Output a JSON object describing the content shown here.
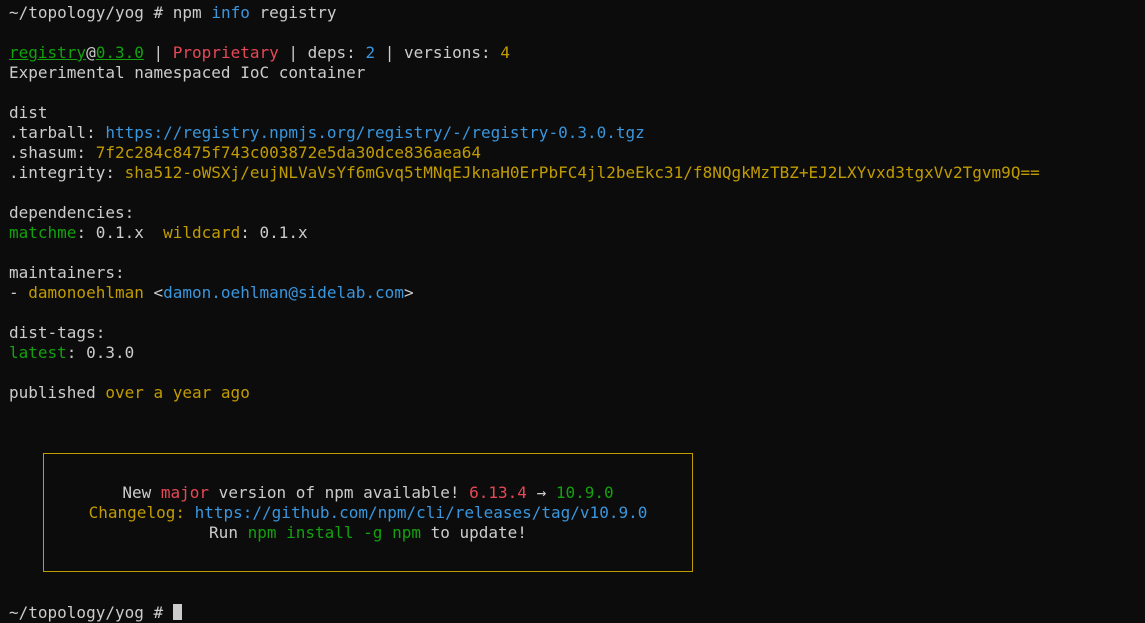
{
  "terminal": {
    "command_line": {
      "prompt": "~/topology/yog # ",
      "cmd": "npm",
      "arg1": "info",
      "arg2": "registry"
    },
    "header": {
      "name": "registry",
      "at": "@",
      "version": "0.3.0",
      "sep1": " | ",
      "license": "Proprietary",
      "sep2": " | deps: ",
      "deps": "2",
      "sep3": " | versions: ",
      "versions": "4"
    },
    "description": "Experimental namespaced IoC container",
    "dist": {
      "heading": "dist",
      "tarball_label": ".tarball: ",
      "tarball": "https://registry.npmjs.org/registry/-/registry-0.3.0.tgz",
      "shasum_label": ".shasum: ",
      "shasum": "7f2c284c8475f743c003872e5da30dce836aea64",
      "integrity_label": ".integrity: ",
      "integrity": "sha512-oWSXj/eujNLVaVsYf6mGvq5tMNqEJknaH0ErPbFC4jl2beEkc31/f8NQgkMzTBZ+EJ2LXYvxd3tgxVv2Tgvm9Q=="
    },
    "dependencies": {
      "heading": "dependencies:",
      "items": [
        {
          "name": "matchme",
          "sep": ": ",
          "version": "0.1.x"
        },
        {
          "name": "wildcard",
          "sep": ": ",
          "version": "0.1.x"
        }
      ]
    },
    "maintainers": {
      "heading": "maintainers:",
      "dash": "- ",
      "name": "damonoehlman",
      "open": " <",
      "email": "damon.oehlman@sidelab.com",
      "close": ">"
    },
    "dist_tags": {
      "heading": "dist-tags:",
      "tag": "latest",
      "sep": ": ",
      "version": "0.3.0"
    },
    "published": {
      "label": "published ",
      "when": "over a year ago"
    },
    "notice": {
      "l1_pre": "New ",
      "l1_kind": "major",
      "l1_mid": " version of npm available! ",
      "l1_from": "6.13.4",
      "l1_arrow": " → ",
      "l1_to": "10.9.0",
      "l2_label": "Changelog: ",
      "l2_url": "https://github.com/npm/cli/releases/tag/v10.9.0",
      "l3_pre": "Run ",
      "l3_cmd": "npm install -g npm",
      "l3_post": " to update!"
    },
    "final_prompt": "~/topology/yog # "
  },
  "colors": {
    "background": "#0c0c0c",
    "foreground": "#cccccc",
    "green": "#13a10e",
    "red": "#e74856",
    "yellow": "#c19c00",
    "cyan": "#3a96dd"
  }
}
